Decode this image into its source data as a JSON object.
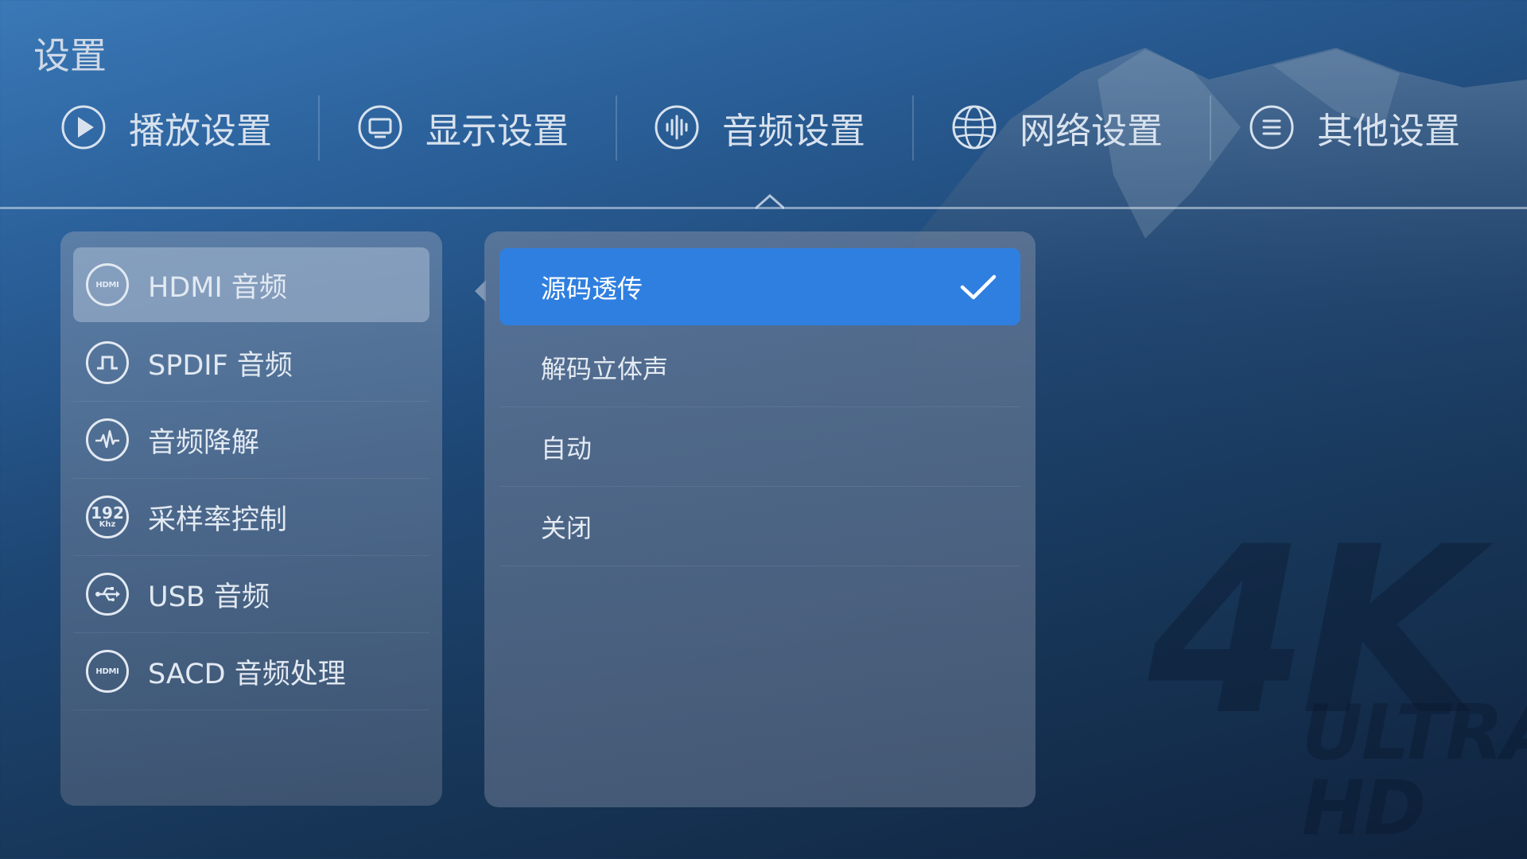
{
  "page": {
    "title": "设置"
  },
  "tabs": [
    {
      "label": "播放设置",
      "icon": "play-icon"
    },
    {
      "label": "显示设置",
      "icon": "monitor-icon"
    },
    {
      "label": "音频设置",
      "icon": "audio-wave-icon",
      "active": true
    },
    {
      "label": "网络设置",
      "icon": "globe-icon"
    },
    {
      "label": "其他设置",
      "icon": "menu-list-icon"
    }
  ],
  "left_menu": {
    "items": [
      {
        "label": "HDMI 音频",
        "icon": "hdmi-icon",
        "icon_text": "HDMI",
        "active": true
      },
      {
        "label": "SPDIF 音频",
        "icon": "spdif-pulse-icon"
      },
      {
        "label": "音频降解",
        "icon": "heartbeat-wave-icon"
      },
      {
        "label": "采样率控制",
        "icon": "sample-rate-icon",
        "icon_text": "192",
        "icon_unit": "Khz"
      },
      {
        "label": "USB 音频",
        "icon": "usb-icon"
      },
      {
        "label": "SACD 音频处理",
        "icon": "hdmi-icon",
        "icon_text": "HDMI"
      }
    ]
  },
  "options": {
    "items": [
      {
        "label": "源码透传",
        "selected": true
      },
      {
        "label": "解码立体声"
      },
      {
        "label": "自动"
      },
      {
        "label": "关闭"
      }
    ]
  },
  "watermark": {
    "big": "4K",
    "small": "ULTRA HD"
  },
  "colors": {
    "accent": "#2f7fe0",
    "background_top": "#3a78b7",
    "background_bottom": "#10233e"
  }
}
